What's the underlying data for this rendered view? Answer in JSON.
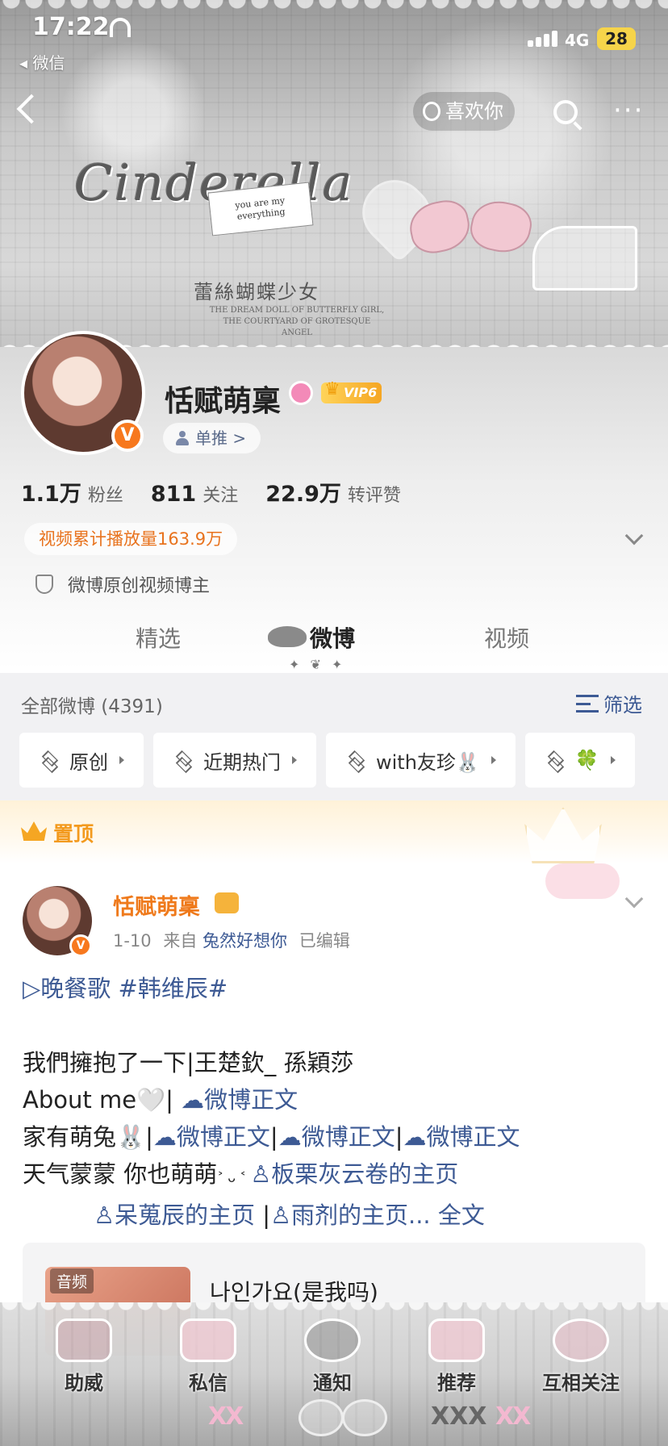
{
  "status_bar": {
    "time": "17:22",
    "back_app": "◂ 微信",
    "network": "4G",
    "battery": "28"
  },
  "nav": {
    "like_label": "喜欢你",
    "more": "···"
  },
  "banner": {
    "title": "Cinderella",
    "card_text": "you are my everything",
    "subtitle": "蕾絲蝴蝶少女",
    "subtitle_en": "THE DREAM DOLL OF BUTTERFLY GIRL, THE COURTYARD OF GROTESQUE ANGEL"
  },
  "profile": {
    "name": "恬赋萌稟",
    "verify_mark": "V",
    "vip_label": "VIP6",
    "single_push_label": "单推 >",
    "stats": [
      {
        "num": "1.1万",
        "label": "粉丝"
      },
      {
        "num": "811",
        "label": "关注"
      },
      {
        "num": "22.9万",
        "label": "转评赞"
      }
    ],
    "play_count": "视频累计播放量163.9万",
    "creator_label": "微博原创视频博主"
  },
  "tabs": [
    {
      "label": "精选"
    },
    {
      "label": "微博"
    },
    {
      "label": "视频"
    }
  ],
  "tab_deco": "✦ ❦ ✦",
  "filter": {
    "all_label": "全部微博 (4391)",
    "filter_label": "筛选",
    "chips": [
      "原创",
      "近期热门",
      "with友珍🐰",
      "🍀"
    ]
  },
  "pinned": {
    "label": "置顶"
  },
  "post": {
    "author": "恬赋萌稟",
    "date": "1-10",
    "from_prefix": "来自",
    "source": "兔然好想你",
    "edited": "已编辑",
    "line1": "▷晚餐歌  #韩维辰#",
    "line2": "我們擁抱了一下|王楚欽_ 孫穎莎",
    "line3a": "About me🤍| ",
    "line3b": "☁微博正文",
    "line4a": "家有萌兔🐰|",
    "line4b": "☁微博正文",
    "line4c": "|",
    "line4d": "☁微博正文",
    "line4e": "|",
    "line4f": "☁微博正文",
    "line5a": "天气蒙蒙 你也萌萌",
    "line5b": "˃ ᴗ ˂ ",
    "line5c": "♙板栗灰云卷的主页",
    "line6a": "♙呆蒐辰的主页",
    "line6b": " |",
    "line6c": "♙雨剂的主页...",
    "line6d": " 全文"
  },
  "audio": {
    "tag": "音频",
    "title": "나인가요(是我吗)"
  },
  "bottom_nav": [
    {
      "label": "助威"
    },
    {
      "label": "私信"
    },
    {
      "label": "通知"
    },
    {
      "label": "推荐"
    },
    {
      "label": "互相关注"
    }
  ],
  "bottom_deco": {
    "xx": "XX",
    "xxx": "XXX"
  },
  "colors": {
    "accent_orange": "#ef7a1c",
    "link_blue": "#3d5a94",
    "pinned_gold": "#f39a1e"
  }
}
